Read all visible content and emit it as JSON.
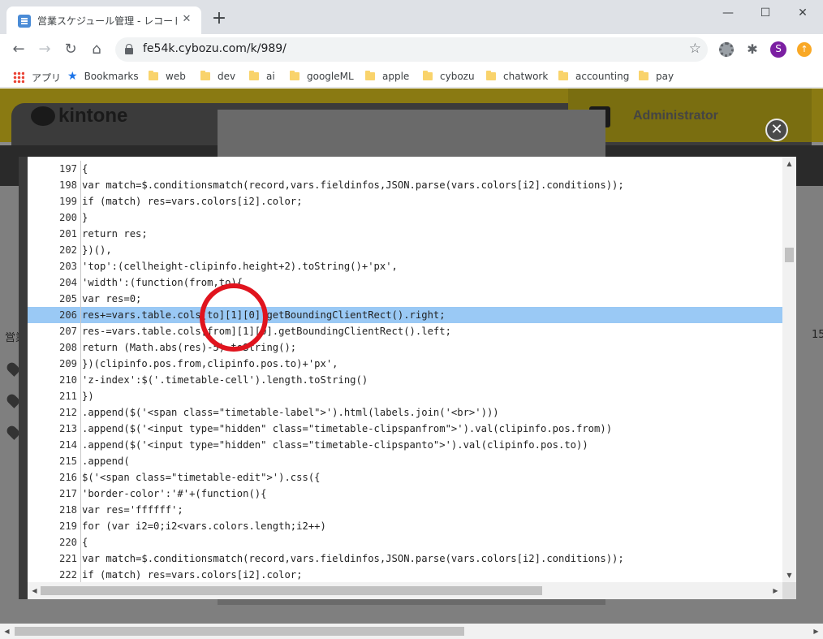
{
  "browser": {
    "tab_title": "営業スケジュール管理 - レコードの一覧",
    "url": "fe54k.cybozu.com/k/989/",
    "avatar_letter": "S",
    "bookmarks": [
      "アプリ",
      "Bookmarks",
      "web",
      "dev",
      "ai",
      "googleML",
      "apple",
      "cybozu",
      "chatwork",
      "accounting",
      "pay"
    ]
  },
  "page": {
    "logo": "kintone",
    "user": "Administrator",
    "side_text": "営業",
    "side_num": "15"
  },
  "code": {
    "lines": [
      {
        "num": "197",
        "text": "{"
      },
      {
        "num": "198",
        "text": "var match=$.conditionsmatch(record,vars.fieldinfos,JSON.parse(vars.colors[i2].conditions));"
      },
      {
        "num": "199",
        "text": "if (match) res=vars.colors[i2].color;"
      },
      {
        "num": "200",
        "text": "}"
      },
      {
        "num": "201",
        "text": "return res;"
      },
      {
        "num": "202",
        "text": "})(),"
      },
      {
        "num": "203",
        "text": "'top':(cellheight-clipinfo.height+2).toString()+'px',"
      },
      {
        "num": "204",
        "text": "'width':(function(from,to){"
      },
      {
        "num": "205",
        "text": "var res=0;"
      },
      {
        "num": "206",
        "text": "res+=vars.table.cols[to][1][0].getBoundingClientRect().right;"
      },
      {
        "num": "207",
        "text": "res-=vars.table.cols[from][1][0].getBoundingClientRect().left;"
      },
      {
        "num": "208",
        "text": "return (Math.abs(res)-5).toString();"
      },
      {
        "num": "209",
        "text": "})(clipinfo.pos.from,clipinfo.pos.to)+'px',"
      },
      {
        "num": "210",
        "text": "'z-index':$('.timetable-cell').length.toString()"
      },
      {
        "num": "211",
        "text": "})"
      },
      {
        "num": "212",
        "text": ".append($('<span class=\"timetable-label\">').html(labels.join('<br>')))"
      },
      {
        "num": "213",
        "text": ".append($('<input type=\"hidden\" class=\"timetable-clipspanfrom\">').val(clipinfo.pos.from))"
      },
      {
        "num": "214",
        "text": ".append($('<input type=\"hidden\" class=\"timetable-clipspanto\">').val(clipinfo.pos.to))"
      },
      {
        "num": "215",
        "text": ".append("
      },
      {
        "num": "216",
        "text": "$('<span class=\"timetable-edit\">').css({"
      },
      {
        "num": "217",
        "text": "'border-color':'#'+(function(){"
      },
      {
        "num": "218",
        "text": "var res='ffffff';"
      },
      {
        "num": "219",
        "text": "for (var i2=0;i2<vars.colors.length;i2++)"
      },
      {
        "num": "220",
        "text": "{"
      },
      {
        "num": "221",
        "text": "var match=$.conditionsmatch(record,vars.fieldinfos,JSON.parse(vars.colors[i2].conditions));"
      },
      {
        "num": "222",
        "text": "if (match) res=vars.colors[i2].color;"
      }
    ],
    "highlighted_line": "206"
  },
  "colors": {
    "highlight": "#9ac9f5",
    "annotation": "#e0141e",
    "avatar": "#7b1fa2"
  }
}
